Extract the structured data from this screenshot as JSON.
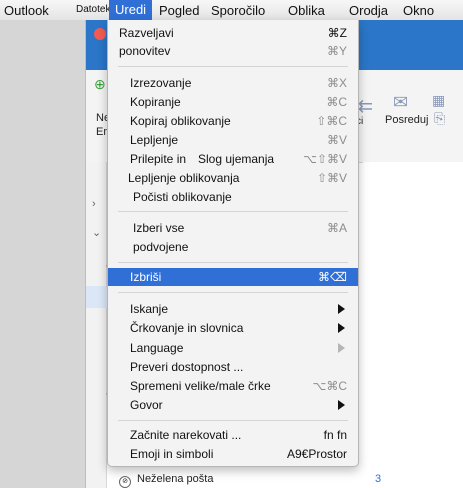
{
  "menubar": {
    "items": [
      "Outlook",
      "Datoteka",
      "Uredi",
      "Pogled",
      "Sporočilo",
      "Oblika",
      "Orodja",
      "Okno"
    ]
  },
  "background": {
    "ribbon_left_label_1": "Ne",
    "ribbon_left_label_2": "Em",
    "forward_label": "Posreduj",
    "partial_label": "ci\nl",
    "junk_label": "Neželena pošta",
    "junk_count": "3"
  },
  "edit_menu": {
    "undo": {
      "label": "Razveljavi",
      "shortcut": "⌘Z"
    },
    "redo": {
      "label": "ponovitev",
      "shortcut": "⌘Y"
    },
    "cut": {
      "label": "Izrezovanje",
      "shortcut": "⌘X"
    },
    "copy": {
      "label": "Kopiranje",
      "shortcut": "⌘C"
    },
    "copy_formatting": {
      "label": "Kopiraj oblikovanje",
      "shortcut": "⇧⌘C"
    },
    "paste": {
      "label": "Lepljenje",
      "shortcut": "⌘V"
    },
    "paste_match_a": "Prilepite in",
    "paste_match_b": "Slog ujemanja",
    "paste_match_shortcut": "⌥⇧⌘V",
    "paste_formatting": {
      "label": "Lepljenje oblikovanja",
      "shortcut": "⇧⌘V"
    },
    "clear_formatting": {
      "label": "Počisti oblikovanje"
    },
    "select_all_a": "Izberi vse",
    "select_all_b": "podvojene",
    "select_all_shortcut": "⌘A",
    "delete": {
      "label": "Izbriši",
      "shortcut": "⌘⌫"
    },
    "find": {
      "label": "Iskanje"
    },
    "spelling": {
      "label": "Črkovanje in slovnica"
    },
    "language": {
      "label": "Language"
    },
    "accessibility": {
      "label": "Preveri dostopnost ..."
    },
    "change_case": {
      "label": "Spremeni velike/male črke",
      "shortcut": "⌥⌘C"
    },
    "speech": {
      "label": "Govor"
    },
    "dictation": {
      "label": "Začnite narekovati ...",
      "shortcut": "fn fn"
    },
    "emoji": {
      "label": "Emoji in simboli",
      "shortcut": "A9€Prostor"
    }
  },
  "colors": {
    "highlight": "#2f6fd6",
    "titlebar": "#2b76c8",
    "menu_bg": "#f3f3f3",
    "disabled_text": "#8d8d8d"
  }
}
